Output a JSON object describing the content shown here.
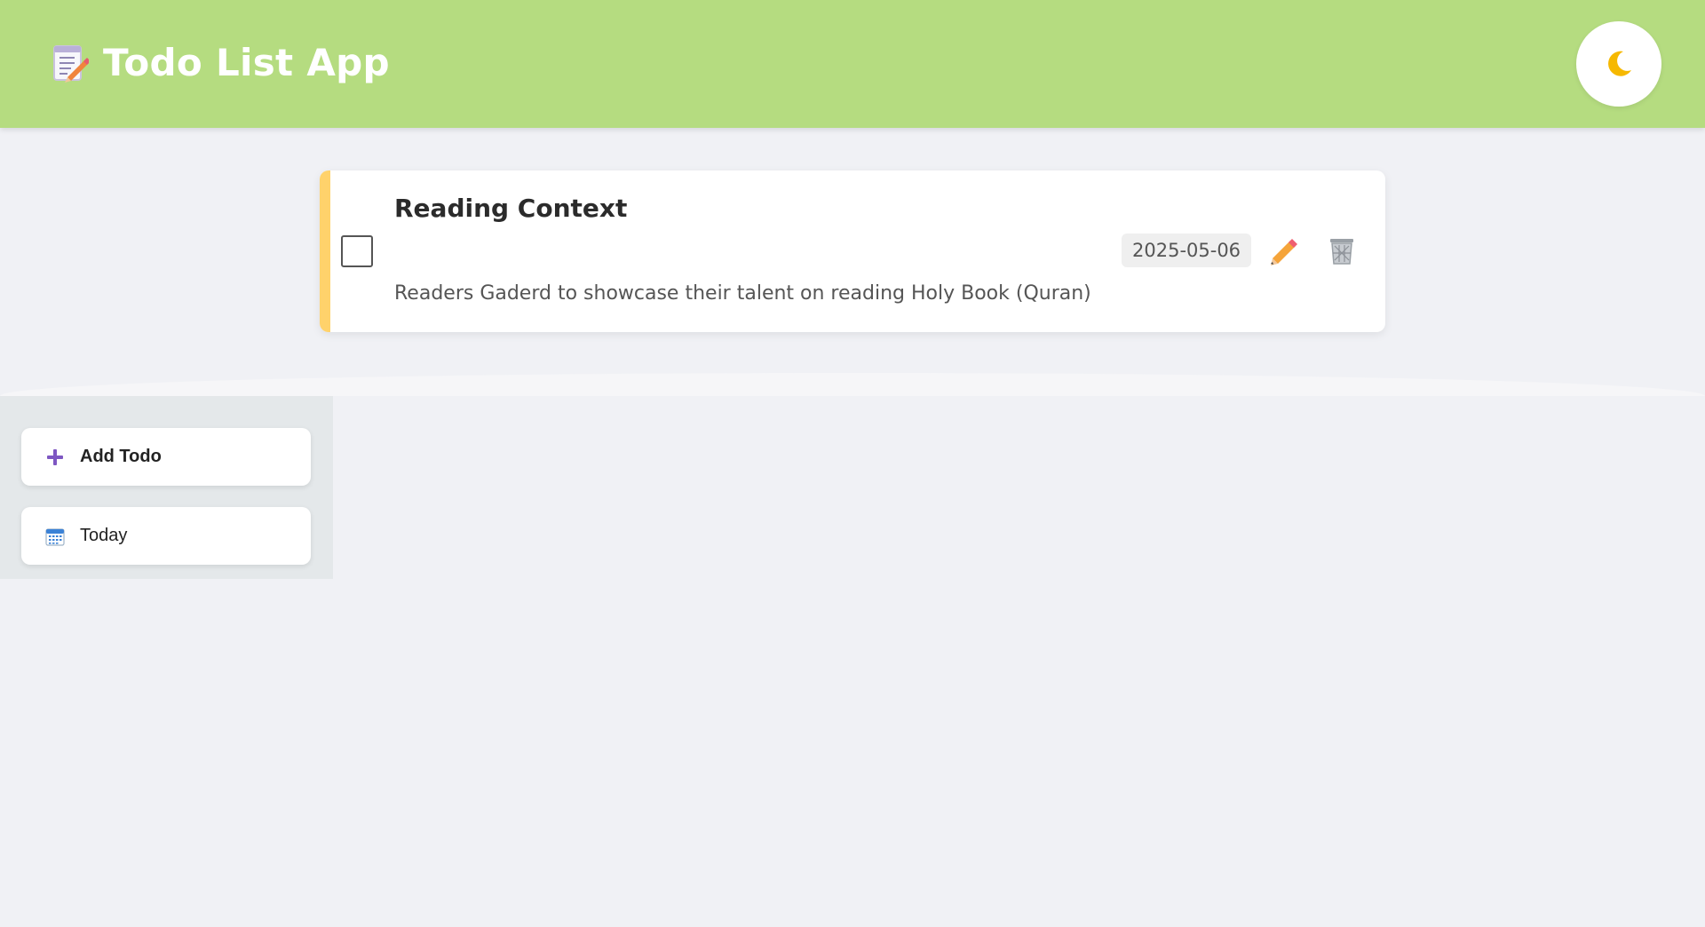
{
  "header": {
    "title": "Todo List App",
    "title_icon": "memo-pencil-icon",
    "theme_toggle_icon": "crescent-moon-icon",
    "background_color": "#b5dc80"
  },
  "todos": [
    {
      "title": "Reading Context",
      "description": "Readers Gaderd to showcase their talent on reading Holy Book (Quran)",
      "date": "2025-05-06",
      "completed": false,
      "accent_color": "#ffd26b",
      "edit_icon": "pencil-icon",
      "delete_icon": "wastebasket-icon"
    }
  ],
  "sidebar": {
    "add_button": {
      "label": "Add Todo",
      "icon": "plus-icon",
      "icon_color": "#7e57c2"
    },
    "today_button": {
      "label": "Today",
      "icon": "calendar-icon"
    }
  }
}
